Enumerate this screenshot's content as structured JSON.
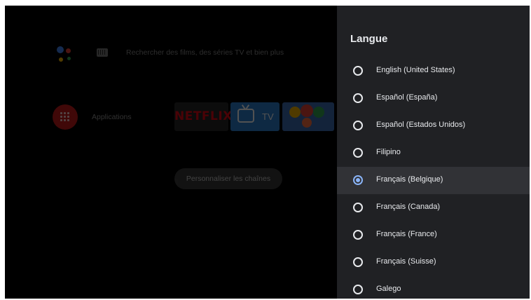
{
  "home": {
    "search_placeholder": "Rechercher des films, des séries TV et bien plus",
    "apps_label": "Applications",
    "apps": [
      {
        "name": "Netflix",
        "label": "NETFLIX"
      },
      {
        "name": "TV",
        "label": "TV"
      },
      {
        "name": "Google Play Games",
        "label": ""
      }
    ],
    "customize_button": "Personnaliser les chaînes",
    "icons": {
      "assistant": "google-assistant-icon",
      "keyboard": "keyboard-icon",
      "apps": "apps-grid-icon"
    }
  },
  "panel": {
    "title": "Langue",
    "languages": [
      {
        "label": "English (United States)",
        "selected": false
      },
      {
        "label": "Español (España)",
        "selected": false
      },
      {
        "label": "Español (Estados Unidos)",
        "selected": false
      },
      {
        "label": "Filipino",
        "selected": false
      },
      {
        "label": "Français (Belgique)",
        "selected": true
      },
      {
        "label": "Français (Canada)",
        "selected": false
      },
      {
        "label": "Français (France)",
        "selected": false
      },
      {
        "label": "Français (Suisse)",
        "selected": false
      },
      {
        "label": "Galego",
        "selected": false
      }
    ]
  },
  "colors": {
    "panel_background": "#202124",
    "focused_row": "#313236",
    "accent": "#8ab4f8",
    "netflix_red": "#e50914",
    "apps_red": "#c61a1a"
  }
}
